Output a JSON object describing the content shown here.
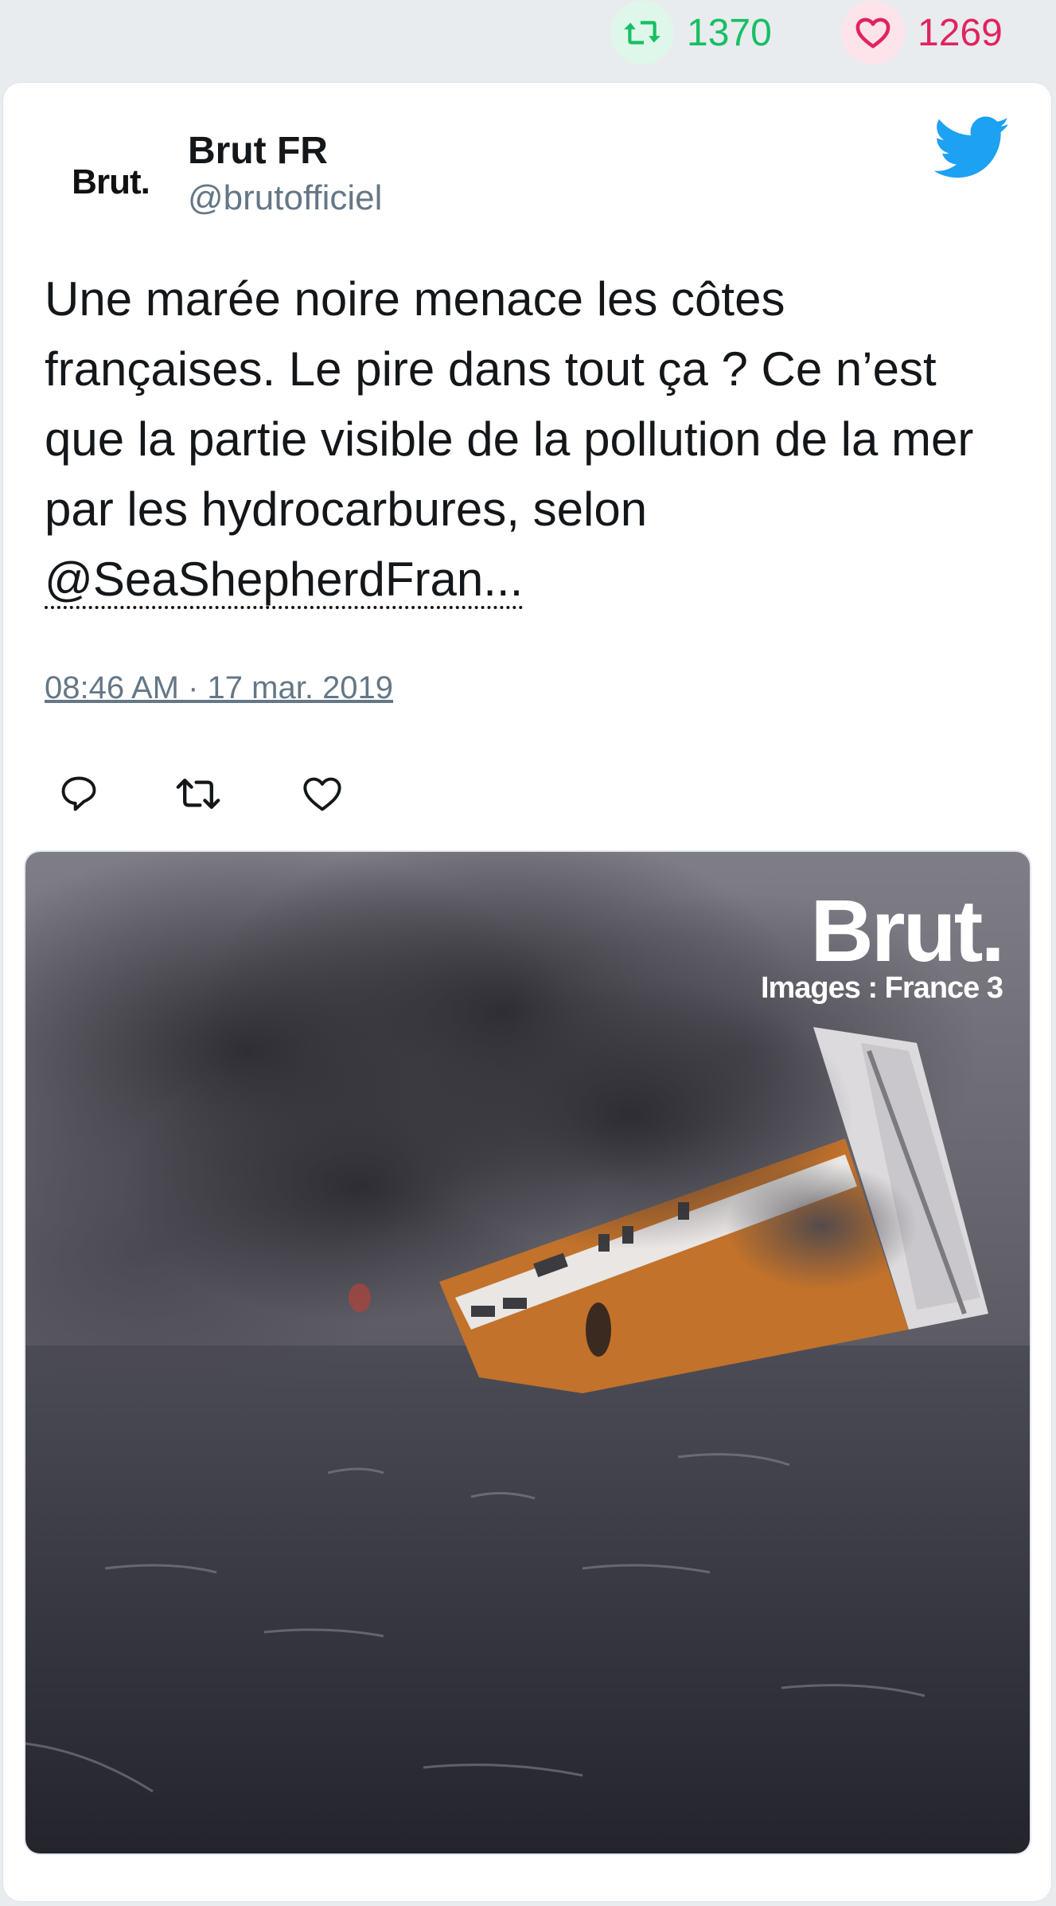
{
  "stats": {
    "retweet_count": "1370",
    "like_count": "1269",
    "retweet_color": "#17bf63",
    "like_color": "#e0245e"
  },
  "tweet": {
    "author_name": "Brut FR",
    "author_handle": "@brutofficiel",
    "avatar_text": "Brut.",
    "text_before_mention": "Une marée noire menace les côtes françaises. Le pire dans tout ça ? Ce n’est que la partie visible de la pollution de la mer par les hydrocarbures, selon ",
    "mention": "@SeaShepherdFran...",
    "timestamp": "08:46 AM · 17 mar. 2019",
    "icons": {
      "platform": "twitter-bird-icon",
      "reply": "reply-icon",
      "retweet": "retweet-icon",
      "like": "heart-icon"
    },
    "brand_color": "#1da1f2"
  },
  "media": {
    "watermark_brand": "Brut.",
    "watermark_credit": "Images : France 3"
  }
}
